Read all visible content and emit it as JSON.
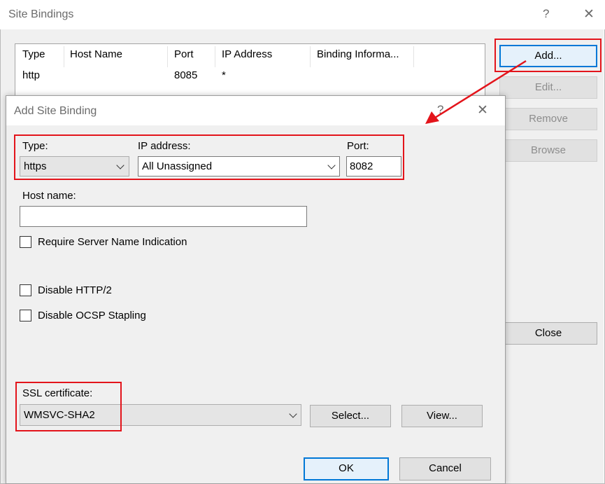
{
  "outer_window": {
    "title": "Site Bindings",
    "help_glyph": "?",
    "close_glyph": "✕",
    "columns": [
      "Type",
      "Host Name",
      "Port",
      "IP Address",
      "Binding Informa..."
    ],
    "rows": [
      {
        "type": "http",
        "host_name": "",
        "port": "8085",
        "ip_address": "*",
        "binding_info": ""
      }
    ],
    "buttons": {
      "add": "Add...",
      "edit": "Edit...",
      "remove": "Remove",
      "browse": "Browse",
      "close": "Close"
    }
  },
  "dialog": {
    "title": "Add Site Binding",
    "help_glyph": "?",
    "close_glyph": "✕",
    "type_label": "Type:",
    "type_value": "https",
    "ip_label": "IP address:",
    "ip_value": "All Unassigned",
    "port_label": "Port:",
    "port_value": "8082",
    "host_label": "Host name:",
    "host_value": "",
    "sni_label": "Require Server Name Indication",
    "sni_checked": false,
    "http2_label": "Disable HTTP/2",
    "http2_checked": false,
    "ocsp_label": "Disable OCSP Stapling",
    "ocsp_checked": false,
    "ssl_label": "SSL certificate:",
    "ssl_value": "WMSVC-SHA2",
    "select_button": "Select...",
    "view_button": "View...",
    "ok_button": "OK",
    "cancel_button": "Cancel"
  },
  "colors": {
    "highlight": "#e3141b",
    "focus_border": "#0078d7",
    "dialog_bg": "#f0f0f0"
  }
}
